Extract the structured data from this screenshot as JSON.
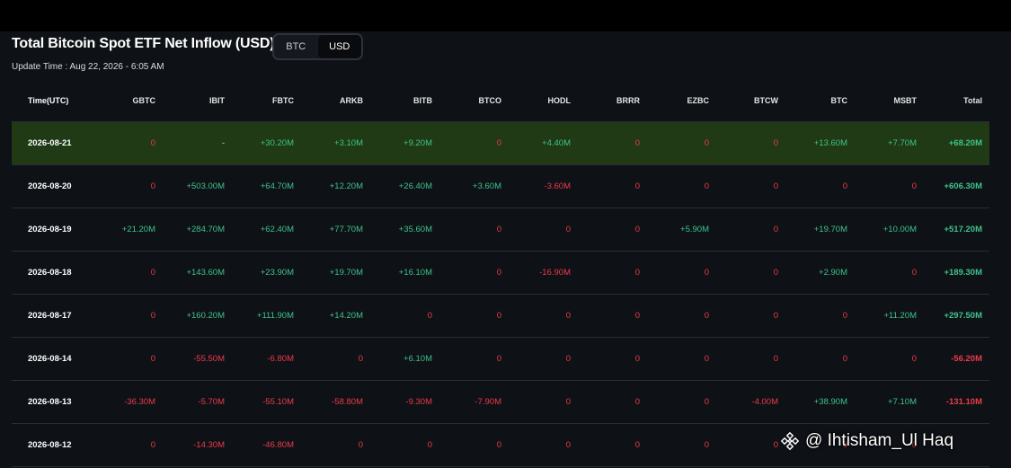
{
  "header": {
    "title": "Total Bitcoin Spot ETF Net Inflow (USD)",
    "update_time": "Update Time : Aug 22, 2026 - 6:05 AM",
    "toggle": {
      "options": [
        "BTC",
        "USD"
      ],
      "selected": "USD"
    }
  },
  "table": {
    "columns": [
      "Time(UTC)",
      "GBTC",
      "IBIT",
      "FBTC",
      "ARKB",
      "BITB",
      "BTCO",
      "HODL",
      "BRRR",
      "EZBC",
      "BTCW",
      "BTC",
      "MSBT",
      "Total"
    ],
    "rows": [
      {
        "date": "2026-08-21",
        "highlight": true,
        "values": [
          "0",
          "-",
          "+30.20M",
          "+3.10M",
          "+9.20M",
          "0",
          "+4.40M",
          "0",
          "0",
          "0",
          "+13.60M",
          "+7.70M",
          "+68.20M"
        ]
      },
      {
        "date": "2026-08-20",
        "values": [
          "0",
          "+503.00M",
          "+64.70M",
          "+12.20M",
          "+26.40M",
          "+3.60M",
          "-3.60M",
          "0",
          "0",
          "0",
          "0",
          "0",
          "+606.30M"
        ]
      },
      {
        "date": "2026-08-19",
        "values": [
          "+21.20M",
          "+284.70M",
          "+62.40M",
          "+77.70M",
          "+35.60M",
          "0",
          "0",
          "0",
          "+5.90M",
          "0",
          "+19.70M",
          "+10.00M",
          "+517.20M"
        ]
      },
      {
        "date": "2026-08-18",
        "values": [
          "0",
          "+143.60M",
          "+23.90M",
          "+19.70M",
          "+16.10M",
          "0",
          "-16.90M",
          "0",
          "0",
          "0",
          "+2.90M",
          "0",
          "+189.30M"
        ]
      },
      {
        "date": "2026-08-17",
        "values": [
          "0",
          "+160.20M",
          "+111.90M",
          "+14.20M",
          "0",
          "0",
          "0",
          "0",
          "0",
          "0",
          "0",
          "+11.20M",
          "+297.50M"
        ]
      },
      {
        "date": "2026-08-14",
        "values": [
          "0",
          "-55.50M",
          "-6.80M",
          "0",
          "+6.10M",
          "0",
          "0",
          "0",
          "0",
          "0",
          "0",
          "0",
          "-56.20M"
        ]
      },
      {
        "date": "2026-08-13",
        "values": [
          "-36.30M",
          "-5.70M",
          "-55.10M",
          "-58.80M",
          "-9.30M",
          "-7.90M",
          "0",
          "0",
          "0",
          "-4.00M",
          "+38.90M",
          "+7.10M",
          "-131.10M"
        ]
      },
      {
        "date": "2026-08-12",
        "values": [
          "0",
          "-14.30M",
          "-46.80M",
          "0",
          "0",
          "0",
          "0",
          "0",
          "0",
          "0",
          "0",
          "0",
          ""
        ]
      }
    ]
  },
  "watermark": {
    "text": "@ Ihtisham_Ul Haq",
    "icon": "binance-logo-icon"
  },
  "colors": {
    "positive": "#3fc38b",
    "negative": "#ee3b49",
    "highlight_row": "#1f3a14",
    "background": "#0e1116"
  }
}
